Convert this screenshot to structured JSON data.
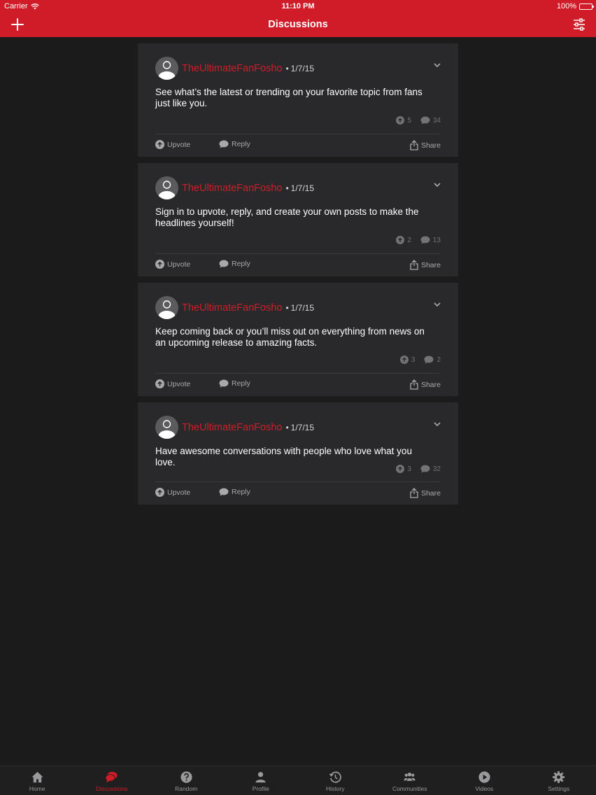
{
  "status_bar": {
    "carrier": "Carrier",
    "time": "11:10 PM",
    "battery": "100%"
  },
  "nav": {
    "title": "Discussions",
    "left_icon": "plus-icon",
    "right_icon": "sliders-icon"
  },
  "posts": [
    {
      "username": "TheUltimateFanFosho",
      "separator": "•",
      "date": "1/7/15",
      "text": "See what’s the latest or trending on your favorite topic from fans just like you.",
      "upvotes": "5",
      "comments": "34",
      "upvote_label": "Upvote",
      "reply_label": "Reply",
      "share_label": "Share"
    },
    {
      "username": "TheUltimateFanFosho",
      "separator": "•",
      "date": "1/7/15",
      "text": "Sign in to upvote, reply, and create your own posts to make the headlines yourself!",
      "upvotes": "2",
      "comments": "13",
      "upvote_label": "Upvote",
      "reply_label": "Reply",
      "share_label": "Share"
    },
    {
      "username": "TheUltimateFanFosho",
      "separator": "•",
      "date": "1/7/15",
      "text": "Keep coming back or you’ll miss out on everything from news on an upcoming release to amazing facts.",
      "upvotes": "3",
      "comments": "2",
      "upvote_label": "Upvote",
      "reply_label": "Reply",
      "share_label": "Share"
    },
    {
      "username": "TheUltimateFanFosho",
      "separator": "•",
      "date": "1/7/15",
      "text": "Have awesome conversations with people who love what you love.",
      "upvotes": "3",
      "comments": "32",
      "upvote_label": "Upvote",
      "reply_label": "Reply",
      "share_label": "Share"
    }
  ],
  "tabs": [
    {
      "label": "Home",
      "icon": "home-icon"
    },
    {
      "label": "Discussions",
      "icon": "discussions-icon",
      "active": true
    },
    {
      "label": "Random",
      "icon": "question-icon"
    },
    {
      "label": "Profile",
      "icon": "person-icon"
    },
    {
      "label": "History",
      "icon": "history-icon"
    },
    {
      "label": "Communities",
      "icon": "people-icon"
    },
    {
      "label": "Videos",
      "icon": "play-icon"
    },
    {
      "label": "Settings",
      "icon": "gear-icon"
    }
  ],
  "colors": {
    "accent": "#d01c29",
    "background": "#1b1b1c",
    "card": "#29292b"
  }
}
